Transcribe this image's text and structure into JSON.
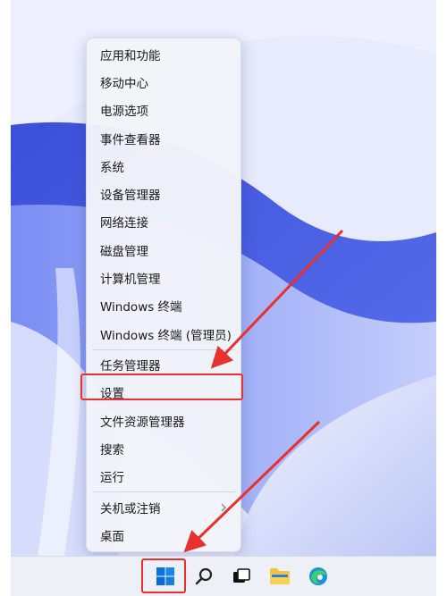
{
  "context_menu": {
    "items": [
      {
        "label": "应用和功能"
      },
      {
        "label": "移动中心"
      },
      {
        "label": "电源选项"
      },
      {
        "label": "事件查看器"
      },
      {
        "label": "系统"
      },
      {
        "label": "设备管理器"
      },
      {
        "label": "网络连接"
      },
      {
        "label": "磁盘管理"
      },
      {
        "label": "计算机管理"
      },
      {
        "label": "Windows 终端"
      },
      {
        "label": "Windows 终端 (管理员)"
      },
      {
        "label": "任务管理器"
      },
      {
        "label": "设置"
      },
      {
        "label": "文件资源管理器"
      },
      {
        "label": "搜索"
      },
      {
        "label": "运行"
      },
      {
        "label": "关机或注销"
      },
      {
        "label": "桌面"
      }
    ],
    "highlighted_item": "设置",
    "submenu_item": "关机或注销"
  },
  "taskbar": {
    "icons": [
      "start-icon",
      "search-icon",
      "task-view-icon",
      "file-explorer-icon",
      "edge-icon"
    ],
    "highlighted_icon": "start-icon"
  },
  "colors": {
    "annotation_red": "#e8302c",
    "windows_blue": "#0a74da",
    "folder_yellow": "#f3c13a"
  }
}
